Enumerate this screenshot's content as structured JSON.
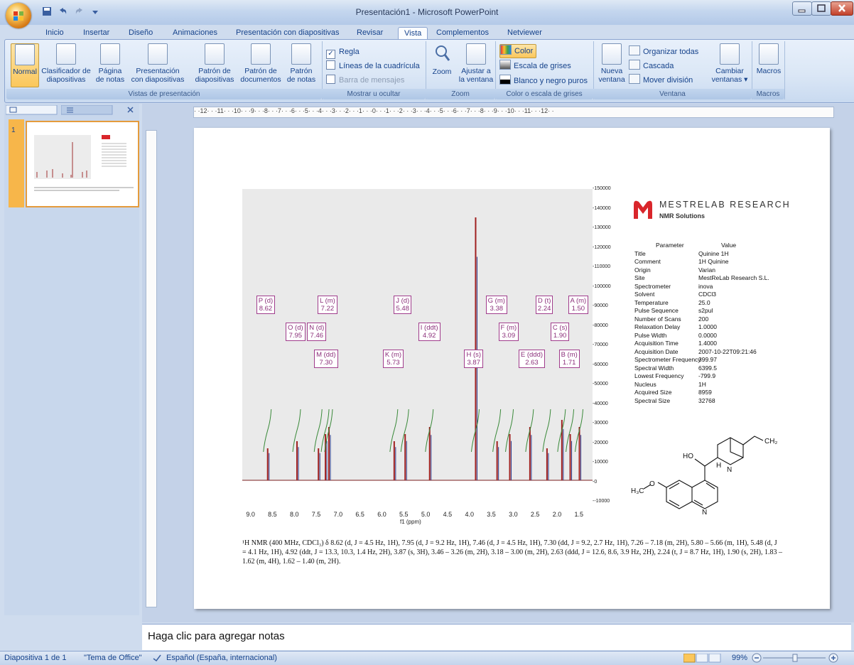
{
  "window": {
    "title": "Presentación1 - Microsoft PowerPoint"
  },
  "tabs": [
    {
      "label": "Inicio"
    },
    {
      "label": "Insertar"
    },
    {
      "label": "Diseño"
    },
    {
      "label": "Animaciones"
    },
    {
      "label": "Presentación con diapositivas"
    },
    {
      "label": "Revisar"
    },
    {
      "label": "Vista"
    },
    {
      "label": "Complementos"
    },
    {
      "label": "Netviewer"
    }
  ],
  "ribbon": {
    "vistas": {
      "label": "Vistas de presentación",
      "normal": "Normal",
      "clasificador": [
        "Clasificador de",
        "diapositivas"
      ],
      "pagina": [
        "Página",
        "de notas"
      ],
      "presentacion": [
        "Presentación",
        "con diapositivas"
      ],
      "patron_diap": [
        "Patrón de",
        "diapositivas"
      ],
      "patron_doc": [
        "Patrón de",
        "documentos"
      ],
      "patron_notas": [
        "Patrón",
        "de notas"
      ]
    },
    "mostrar": {
      "label": "Mostrar u ocultar",
      "regla": "Regla",
      "lineas": "Líneas de la cuadrícula",
      "barra": "Barra de mensajes"
    },
    "zoom": {
      "label": "Zoom",
      "zoom": "Zoom",
      "ajustar": [
        "Ajustar a",
        "la ventana"
      ]
    },
    "color": {
      "label": "Color o escala de grises",
      "color": "Color",
      "grises": "Escala de grises",
      "byn": "Blanco y negro puros"
    },
    "ventana": {
      "label": "Ventana",
      "nueva": [
        "Nueva",
        "ventana"
      ],
      "organizar": "Organizar todas",
      "cascada": "Cascada",
      "mover": "Mover división",
      "cambiar": [
        "Cambiar",
        "ventanas ▾"
      ]
    },
    "macros": {
      "label": "Macros",
      "btn": "Macros"
    }
  },
  "panel": {
    "slide_number": "1"
  },
  "ruler": {
    "h": "· ·12· · ·11· · ·10· · ·9· · ·8· · ·7· · ·6· · ·5· · ·4· · ·3· · ·2· · ·1· · ·0· · ·1· · ·2· · ·3· · ·4· · ·5· · ·6· · ·7· · ·8· · ·9· · ·10· · ·11· · ·12· ·"
  },
  "slide": {
    "brand": {
      "name": "MESTRELAB RESEARCH",
      "sub": "NMR Solutions",
      "brand_color": "#d9262b"
    },
    "params_header": {
      "k": "Parameter",
      "v": "Value"
    },
    "params": [
      {
        "k": "Title",
        "v": "Quinine 1H"
      },
      {
        "k": "Comment",
        "v": "1H Quinine"
      },
      {
        "k": "Origin",
        "v": "Varian"
      },
      {
        "k": "Site",
        "v": "MestReLab Research S.L."
      },
      {
        "k": "Spectrometer",
        "v": "inova"
      },
      {
        "k": "Solvent",
        "v": "CDCl3"
      },
      {
        "k": "Temperature",
        "v": "25.0"
      },
      {
        "k": "Pulse Sequence",
        "v": "s2pul"
      },
      {
        "k": "Number of Scans",
        "v": "200"
      },
      {
        "k": "Relaxation Delay",
        "v": "1.0000"
      },
      {
        "k": "Pulse Width",
        "v": "0.0000"
      },
      {
        "k": "Acquisition Time",
        "v": "1.4000"
      },
      {
        "k": "Acquisition Date",
        "v": "2007-10-22T09:21:46"
      },
      {
        "k": "Spectrometer Frequency",
        "v": "399.97"
      },
      {
        "k": "Spectral Width",
        "v": "6399.5"
      },
      {
        "k": "Lowest Frequency",
        "v": "-799.9"
      },
      {
        "k": "Nucleus",
        "v": "1H"
      },
      {
        "k": "Acquired Size",
        "v": "8959"
      },
      {
        "k": "Spectral Size",
        "v": "32768"
      }
    ],
    "xaxis_label": "f1 (ppm)",
    "xticks": [
      "9.0",
      "8.5",
      "8.0",
      "7.5",
      "7.0",
      "6.5",
      "6.0",
      "5.5",
      "5.0",
      "4.5",
      "4.0",
      "3.5",
      "3.0",
      "2.5",
      "2.0",
      "1.5"
    ],
    "yticks": [
      "150000",
      "140000",
      "130000",
      "120000",
      "110000",
      "100000",
      "90000",
      "80000",
      "70000",
      "60000",
      "50000",
      "40000",
      "30000",
      "20000",
      "10000",
      "0",
      "-10000"
    ],
    "peaks": [
      {
        "id": "P (d)",
        "ppm": "8.62"
      },
      {
        "id": "O (d)",
        "ppm": "7.95"
      },
      {
        "id": "M (dd)",
        "ppm": "7.30"
      },
      {
        "id": "L (m)",
        "ppm": "7.22"
      },
      {
        "id": "N (d)",
        "ppm": "7.46"
      },
      {
        "id": "K (m)",
        "ppm": "5.73"
      },
      {
        "id": "J (d)",
        "ppm": "5.48"
      },
      {
        "id": "I (ddt)",
        "ppm": "4.92"
      },
      {
        "id": "H (s)",
        "ppm": "3.87"
      },
      {
        "id": "G (m)",
        "ppm": "3.38"
      },
      {
        "id": "F (m)",
        "ppm": "3.09"
      },
      {
        "id": "E (ddd)",
        "ppm": "2.63"
      },
      {
        "id": "D (t)",
        "ppm": "2.24"
      },
      {
        "id": "C (s)",
        "ppm": "1.90"
      },
      {
        "id": "B (m)",
        "ppm": "1.71"
      },
      {
        "id": "A (m)",
        "ppm": "1.50"
      }
    ],
    "caption": "¹H NMR (400 MHz, CDCl₃) δ 8.62 (d, J = 4.5 Hz, 1H), 7.95 (d, J = 9.2 Hz, 1H), 7.46 (d, J = 4.5 Hz, 1H), 7.30 (dd, J = 9.2, 2.7 Hz, 1H), 7.26 – 7.18 (m, 2H), 5.80 – 5.66 (m, 1H), 5.48 (d, J = 4.1 Hz, 1H), 4.92 (ddt, J = 13.3, 10.3, 1.4 Hz, 2H), 3.87 (s, 3H), 3.46 – 3.26 (m, 2H), 3.18 – 3.00 (m, 2H), 2.63 (ddd, J = 12.6, 8.6, 3.9 Hz, 2H), 2.24 (t, J = 8.7 Hz, 1H), 1.90 (s, 2H), 1.83 – 1.62 (m, 4H), 1.62 – 1.40 (m, 2H).",
    "molecule": {
      "ho": "HO",
      "h": "H",
      "n": "N",
      "ch2": "CH₂",
      "h3c": "H₃C"
    }
  },
  "notes": {
    "placeholder": "Haga clic para agregar notas"
  },
  "status": {
    "slide": "Diapositiva 1 de 1",
    "theme": "\"Tema de Office\"",
    "lang": "Español (España, internacional)",
    "zoom": "99%"
  }
}
